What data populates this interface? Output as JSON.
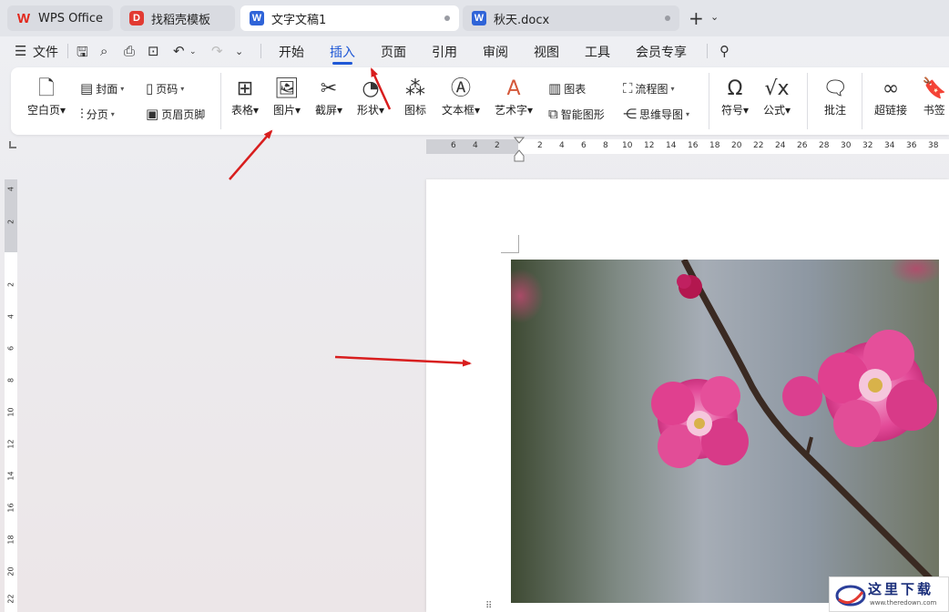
{
  "tabs": [
    {
      "label": "WPS Office",
      "icon": "wps-logo-icon"
    },
    {
      "label": "找稻壳模板",
      "icon": "docer-icon"
    },
    {
      "label": "文字文稿1",
      "icon": "word-doc-icon",
      "active": true
    },
    {
      "label": "秋天.docx",
      "icon": "word-doc-icon"
    }
  ],
  "menu": {
    "file": "文件",
    "items": [
      "开始",
      "插入",
      "页面",
      "引用",
      "审阅",
      "视图",
      "工具",
      "会员专享"
    ],
    "active": "插入"
  },
  "ribbon": {
    "blank_page": "空白页",
    "cover": "封面",
    "page_break": "分页",
    "page_number": "页码",
    "header_footer": "页眉页脚",
    "table": "表格",
    "picture": "图片",
    "screenshot": "截屏",
    "shape": "形状",
    "icon": "图标",
    "textbox": "文本框",
    "wordart": "艺术字",
    "chart": "图表",
    "smartart": "智能图形",
    "flowchart": "流程图",
    "mindmap": "思维导图",
    "symbol": "符号",
    "formula": "公式",
    "comment": "批注",
    "hyperlink": "超链接",
    "bookmark": "书签"
  },
  "hruler_labels": [
    "6",
    "4",
    "2",
    "2",
    "4",
    "6",
    "8",
    "10",
    "12",
    "14",
    "16",
    "18",
    "20",
    "22",
    "24",
    "26",
    "28",
    "30",
    "32",
    "34",
    "36",
    "38"
  ],
  "vruler_labels": [
    "4",
    "2",
    "2",
    "4",
    "6",
    "8",
    "10",
    "12",
    "14",
    "16",
    "18",
    "20",
    "22"
  ],
  "watermark": {
    "text": "这里下载",
    "url": "www.theredown.com"
  },
  "colors": {
    "accent": "#1f58d6",
    "arrow": "#d81e1e",
    "blossom": "#e0408f"
  }
}
